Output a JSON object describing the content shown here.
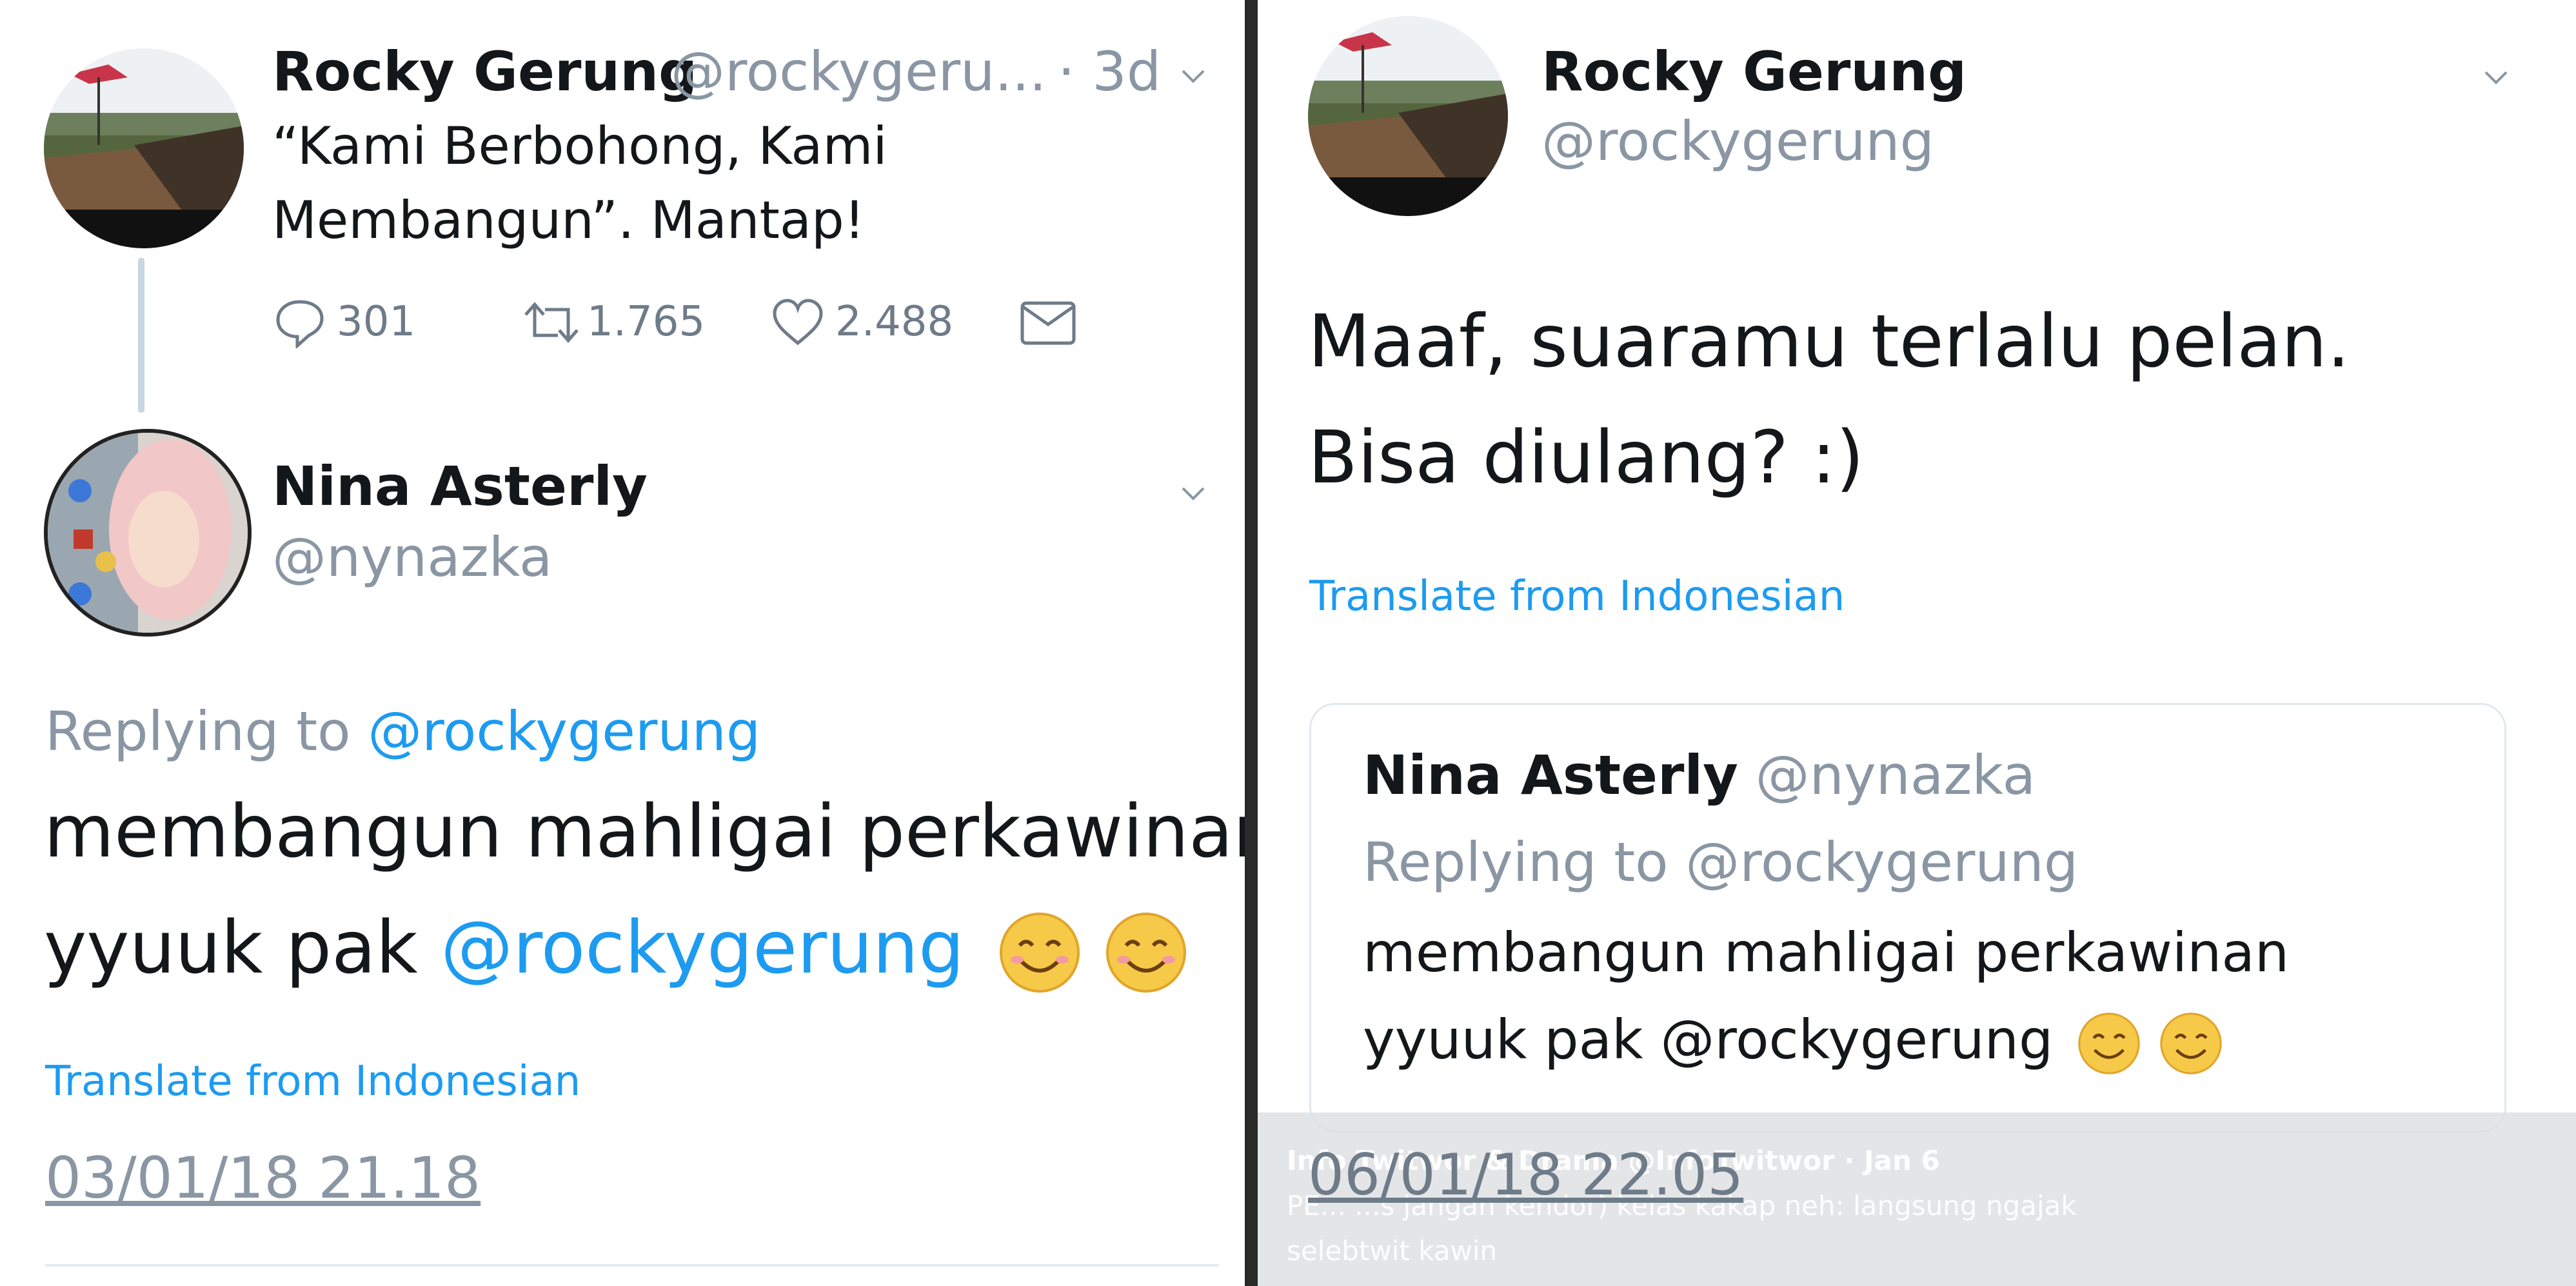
{
  "colors": {
    "link": "#1d9bf0",
    "muted": "#8a96a3",
    "text": "#14171a",
    "divider": "#2a2a2a"
  },
  "left": {
    "parent_tweet": {
      "name": "Rocky Gerung",
      "handle": "@rockygeru...",
      "time": "· 3d",
      "text_line1": "“Kami Berbohong, Kami",
      "text_line2": "Membangun”. Mantap!",
      "actions": {
        "replies": "301",
        "retweets": "1.765",
        "likes": "2.488"
      }
    },
    "reply_tweet": {
      "name": "Nina Asterly",
      "handle": "@nynazka",
      "replying_prefix": "Replying to ",
      "replying_handle": "@rockygerung",
      "text_line1": "membangun mahligai perkawinan",
      "text_line2_prefix": "yyuuk pak ",
      "text_line2_mention": "@rockygerung",
      "translate": "Translate from Indonesian",
      "timestamp": "03/01/18 21.18"
    }
  },
  "right": {
    "tweet": {
      "name": "Rocky Gerung",
      "handle": "@rockygerung",
      "text_line1": "Maaf, suaramu terlalu pelan.",
      "text_line2": "Bisa diulang? :)",
      "translate": "Translate from Indonesian",
      "timestamp": "06/01/18 22.05"
    },
    "quoted": {
      "name": "Nina Asterly",
      "handle": "@nynazka",
      "replying": "Replying to @rockygerung",
      "text_line1": "membangun mahligai perkawinan",
      "text_line2": "yyuuk pak @rockygerung"
    },
    "overlay": {
      "line1": "Info Twitwor & Drama @InfoTwitwor · Jan 6",
      "line2": "PE... ...s jangan kendor) kelas kakap neh: langsung ngajak",
      "line3": "selebtwit kawin"
    }
  }
}
